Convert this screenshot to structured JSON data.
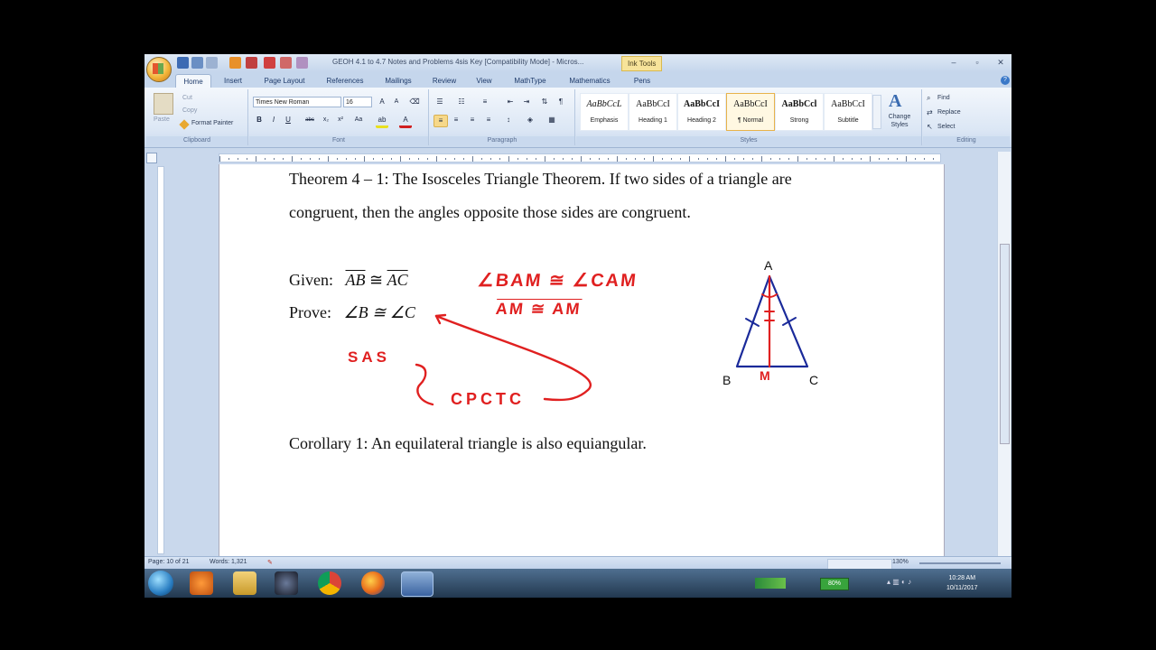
{
  "window": {
    "title": "GEOH 4.1 to 4.7 Notes and Problems 4sis Key [Compatibility Mode] - Micros...",
    "context_tab": "Ink Tools",
    "min": "–",
    "max": "▫",
    "close": "✕"
  },
  "tabs": [
    "Home",
    "Insert",
    "Page Layout",
    "References",
    "Mailings",
    "Review",
    "View",
    "MathType",
    "Mathematics",
    "Pens"
  ],
  "ribbon": {
    "clipboard": {
      "paste": "Paste",
      "cut": "Cut",
      "copy": "Copy",
      "format_painter": "Format Painter",
      "label": "Clipboard"
    },
    "font": {
      "name": "Times New Roman",
      "size": "16",
      "label": "Font"
    },
    "paragraph": {
      "label": "Paragraph"
    },
    "styles": {
      "items": [
        {
          "sample": "AaBbCcL",
          "name": "Emphasis"
        },
        {
          "sample": "AaBbCcI",
          "name": "Heading 1"
        },
        {
          "sample": "AaBbCcI",
          "name": "Heading 2"
        },
        {
          "sample": "AaBbCcI",
          "name": "¶ Normal"
        },
        {
          "sample": "AaBbCcl",
          "name": "Strong"
        },
        {
          "sample": "AaBbCcI",
          "name": "Subtitle"
        }
      ],
      "change_styles": "Change Styles",
      "label": "Styles"
    },
    "editing": {
      "find": "Find",
      "replace": "Replace",
      "select": "Select",
      "label": "Editing"
    }
  },
  "document": {
    "theorem_line1": "Theorem 4 – 1:  The Isosceles Triangle Theorem.  If two sides of a triangle are",
    "theorem_line2": "congruent, then the angles opposite those sides are congruent.",
    "given_label": "Given:",
    "given_a": "AB",
    "given_cong": "≅",
    "given_b": "AC",
    "prove_label": "Prove:",
    "prove_expr": "∠B ≅ ∠C",
    "corollary": "Corollary 1:  An equilateral triangle is also equiangular.",
    "vertex_a": "A",
    "vertex_b": "B",
    "vertex_c": "C",
    "ink": {
      "angle_congruence": "∠BAM ≅ ∠CAM",
      "segment_congruence": "AM ≅ AM",
      "sas": "SAS",
      "cpctc": "CPCTC",
      "midpoint": "M"
    },
    "ink_color": "#e02020",
    "triangle_color": "#1a2a9a"
  },
  "status": {
    "page": "Page: 10 of 21",
    "words": "Words: 1,321",
    "zoom": "130%"
  },
  "taskbar": {
    "battery": "80%",
    "time": "10:28 AM",
    "date": "10/11/2017"
  }
}
